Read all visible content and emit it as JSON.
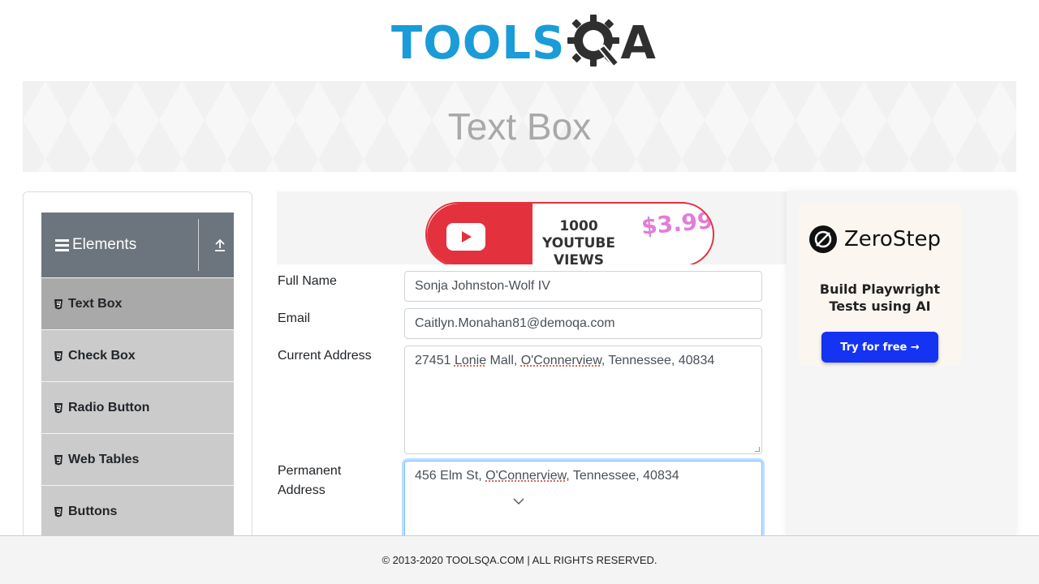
{
  "logo": {
    "word": "TOOLS",
    "suffix": "A",
    "colors": {
      "tools": "#1a9cd8",
      "qa": "#2f2f2f"
    }
  },
  "page_title": "Text Box",
  "sidebar": {
    "group_title": "Elements",
    "items": [
      {
        "label": "Text Box",
        "active": true
      },
      {
        "label": "Check Box",
        "active": false
      },
      {
        "label": "Radio Button",
        "active": false
      },
      {
        "label": "Web Tables",
        "active": false
      },
      {
        "label": "Buttons",
        "active": false
      }
    ]
  },
  "ad_top": {
    "line1": "1000",
    "line2": "YOUTUBE VIEWS",
    "price": "$3.99"
  },
  "form": {
    "full_name": {
      "label": "Full Name",
      "value": "Sonja Johnston-Wolf IV"
    },
    "email": {
      "label": "Email",
      "value": "Caitlyn.Monahan81@demoqa.com"
    },
    "current_address": {
      "label": "Current Address",
      "parts": [
        "27451 ",
        "Lonie",
        " Mall, ",
        "O'Connerview",
        ", Tennessee, 40834"
      ]
    },
    "permanent_address": {
      "label_line1": "Permanent",
      "label_line2": "Address",
      "parts": [
        "456 Elm St, ",
        "O'Connerview",
        ", Tennessee, 40834"
      ]
    }
  },
  "right_ad": {
    "brand": "ZeroStep",
    "tagline_line1": "Build Playwright",
    "tagline_line2": "Tests using AI",
    "cta": "Try for free →",
    "cta_color": "#1433f2"
  },
  "footer": {
    "text": "© 2013-2020 TOOLSQA.COM | ALL RIGHTS RESERVED."
  }
}
